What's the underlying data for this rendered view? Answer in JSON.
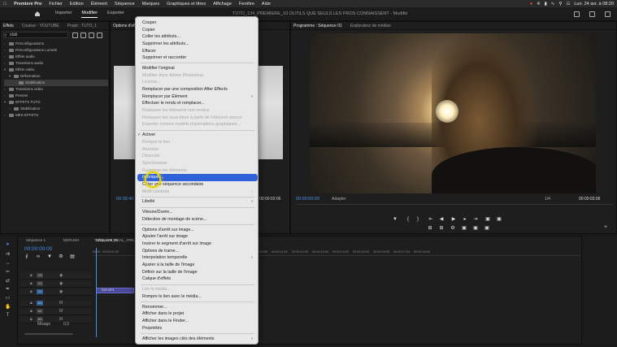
{
  "menubar": {
    "app": "Premiere Pro",
    "items": [
      "Fichier",
      "Edition",
      "Élément",
      "Séquence",
      "Marques",
      "Graphiques et titres",
      "Affichage",
      "Fenêtre",
      "Aide"
    ],
    "datetime": "Lun. 24 avr. à 08:20"
  },
  "header": {
    "tabs": [
      "Importer",
      "Modifier",
      "Exporter"
    ],
    "active_tab": "Modifier",
    "project_title": "TUTO_134_PREMIERE_10 OUTILS QUE SEULS LES PROS CONNAISSENT - Modifié"
  },
  "effects_panel": {
    "tabs": [
      "Effets",
      "Couleur - YOUTUBE",
      "Projet : TUTO_1"
    ],
    "search_value": "stab",
    "tree": [
      {
        "label": "Préconfigurations",
        "level": 0,
        "expanded": false
      },
      {
        "label": "Préconfigurations Lumetri",
        "level": 0,
        "expanded": false
      },
      {
        "label": "Effets audio",
        "level": 0,
        "expanded": false
      },
      {
        "label": "Transitions audio",
        "level": 0,
        "expanded": false
      },
      {
        "label": "Effets vidéo",
        "level": 0,
        "expanded": true
      },
      {
        "label": "Déformation",
        "level": 1,
        "expanded": true
      },
      {
        "label": "Stabilisation",
        "level": 2,
        "expanded": false,
        "selected": true
      },
      {
        "label": "Transitions vidéo",
        "level": 0,
        "expanded": false
      },
      {
        "label": "Presets",
        "level": 0,
        "expanded": false
      },
      {
        "label": "EFFETS TUTO",
        "level": 0,
        "expanded": true
      },
      {
        "label": "Stabilisation",
        "level": 1,
        "expanded": false
      },
      {
        "label": "MES EFFETS",
        "level": 0,
        "expanded": false
      }
    ]
  },
  "source_panel": {
    "tabs": [
      "Options d'effet"
    ],
    "timecode": "00:36:40"
  },
  "program_monitor": {
    "tabs": [
      "Programme : Séquence 01",
      "Explorateur de médias"
    ],
    "timecode_left": "00:00:00:00",
    "fit": "Adapter",
    "ratio": "1/4",
    "timecode_right": "00:00:03:06",
    "source_end_tc": "00:00:03:06"
  },
  "timeline": {
    "tabs": [
      "Séquence 1",
      "DERUSH",
      "TUTO_109_REAL_ATELI",
      "Séquence 01"
    ],
    "timecode": "00:00:00:00",
    "ruler_ticks": [
      "00:00",
      "00:00:01:00",
      "00:00:07:00",
      "00:00:08:00",
      "00:00:09:00",
      "00:00:10:00",
      "00:00:11:00",
      "00:00:12:00",
      "00:00:13:00",
      "00:00:14:00",
      "00:00:15:00",
      "00:00:16:00",
      "00:00:17:00",
      "00:00:18:00"
    ],
    "video_tracks": [
      "V3",
      "V2",
      "V1"
    ],
    "audio_tracks": [
      "A1",
      "A2",
      "A3"
    ],
    "master_label": "Mixage",
    "master_value": "0,0",
    "clip_label": "DJI0 MP4"
  },
  "context_menu": {
    "items": [
      {
        "label": "Couper",
        "enabled": true
      },
      {
        "label": "Copier",
        "enabled": true
      },
      {
        "label": "Coller les attributs...",
        "enabled": true
      },
      {
        "label": "Supprimer les attributs...",
        "enabled": true
      },
      {
        "label": "Effacer",
        "enabled": true
      },
      {
        "label": "Supprimer et raccorder",
        "enabled": true
      },
      {
        "sep": true
      },
      {
        "label": "Modifier l'original",
        "enabled": true
      },
      {
        "label": "Modifier dans Adobe Photoshop",
        "enabled": false
      },
      {
        "label": "Licence...",
        "enabled": false
      },
      {
        "label": "Remplacer par une composition After Effects",
        "enabled": true
      },
      {
        "label": "Remplacer par Élément",
        "enabled": true,
        "submenu": true
      },
      {
        "label": "Effectuer le rendu et remplacer...",
        "enabled": true
      },
      {
        "label": "Restaurer les éléments non rendus",
        "enabled": false
      },
      {
        "label": "Restaurer les sous-titres à partir de l'élément source",
        "enabled": false
      },
      {
        "label": "Exporter comme modèle d'animations graphiques...",
        "enabled": false
      },
      {
        "sep": true
      },
      {
        "label": "Activer",
        "enabled": true,
        "checked": true
      },
      {
        "label": "Rompre le lien",
        "enabled": false
      },
      {
        "label": "Associer",
        "enabled": false
      },
      {
        "label": "Dissocier",
        "enabled": false
      },
      {
        "label": "Synchroniser",
        "enabled": false
      },
      {
        "label": "Fusionner les éléments",
        "enabled": false
      },
      {
        "label": "Imbriquer...",
        "enabled": true,
        "highlighted": true
      },
      {
        "label": "Créer une séquence secondaire",
        "enabled": true
      },
      {
        "label": "Multi-caméras",
        "enabled": false,
        "submenu": true
      },
      {
        "sep": true
      },
      {
        "label": "Libellé",
        "enabled": true,
        "submenu": true
      },
      {
        "sep": true
      },
      {
        "label": "Vitesse/Durée...",
        "enabled": true
      },
      {
        "label": "Détection de montage de scène...",
        "enabled": true
      },
      {
        "sep": true
      },
      {
        "label": "Options d'arrêt sur image...",
        "enabled": true
      },
      {
        "label": "Ajouter l'arrêt sur image",
        "enabled": true
      },
      {
        "label": "Insérer le segment d'arrêt sur image",
        "enabled": true
      },
      {
        "label": "Options de trame...",
        "enabled": true
      },
      {
        "label": "Interpolation temporelle",
        "enabled": true,
        "submenu": true
      },
      {
        "label": "Ajuster à la taille de l'image",
        "enabled": true
      },
      {
        "label": "Définir sur la taille de l'image",
        "enabled": true
      },
      {
        "label": "Calque d'effets",
        "enabled": true
      },
      {
        "sep": true
      },
      {
        "label": "Lier le média...",
        "enabled": false
      },
      {
        "label": "Rompre le lien avec le média...",
        "enabled": true
      },
      {
        "sep": true
      },
      {
        "label": "Renommer...",
        "enabled": true
      },
      {
        "label": "Afficher dans le projet",
        "enabled": true
      },
      {
        "label": "Afficher dans le Finder...",
        "enabled": true
      },
      {
        "label": "Propriétés",
        "enabled": true
      },
      {
        "sep": true
      },
      {
        "label": "Afficher les images clés des éléments",
        "enabled": true,
        "submenu": true
      }
    ]
  }
}
